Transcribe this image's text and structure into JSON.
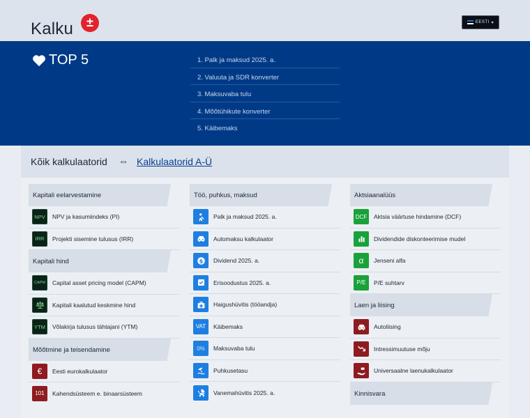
{
  "header": {
    "logo": "Kalku",
    "logo_badge": "±",
    "language": "EESTI"
  },
  "top5": {
    "title": "TOP 5",
    "items": [
      "1. Palk ja maksud 2025. a.",
      "2. Valuuta ja SDR konverter",
      "3. Maksuvaba tulu",
      "4. Mõõtühikute konverter",
      "5. Käibemaks"
    ]
  },
  "panel": {
    "title": "Kõik kalkulaatorid",
    "arrow": "⇔",
    "link": "Kalkulaatorid A-Ü"
  },
  "col1": {
    "s1": {
      "title": "Kapitali eelarvestamine",
      "items": [
        {
          "icon": "NPV",
          "label": "NPV ja kasumiindeks (PI)"
        },
        {
          "icon": "IRR",
          "label": "Projekti sisemine tulusus (IRR)"
        }
      ]
    },
    "s2": {
      "title": "Kapitali hind",
      "items": [
        {
          "icon": "CAPM",
          "label": "Capital asset pricing model (CAPM)"
        },
        {
          "icon": "scales-icon",
          "label": "Kapitali kaalutud keskmine hind"
        },
        {
          "icon": "YTM",
          "label": "Võlakirja tulusus tähtajani (YTM)"
        }
      ]
    },
    "s3": {
      "title": "Mõõtmine ja teisendamine",
      "items": [
        {
          "icon": "€",
          "label": "Eesti eurokalkulaator"
        },
        {
          "icon": "101",
          "label": "Kahendsüsteem e. binaarsüsteem"
        }
      ]
    }
  },
  "col2": {
    "s1": {
      "title": "Töö, puhkus, maksud",
      "items": [
        {
          "icon": "worker-icon",
          "label": "Palk ja maksud 2025. a."
        },
        {
          "icon": "car-icon",
          "label": "Automaksu kalkulaator"
        },
        {
          "icon": "$",
          "label": "Dividend 2025. a."
        },
        {
          "icon": "checkbox-icon",
          "label": "Erisoodustus 2025. a."
        },
        {
          "icon": "medkit-icon",
          "label": "Haigushüvitis (tööandja)"
        },
        {
          "icon": "VAT",
          "label": "Käibemaks"
        },
        {
          "icon": "0%",
          "label": "Maksuvaba tulu"
        },
        {
          "icon": "beach-icon",
          "label": "Puhkusetasu"
        },
        {
          "icon": "stroller-icon",
          "label": "Vanemahüvitis 2025. a."
        }
      ]
    }
  },
  "col3": {
    "s1": {
      "title": "Aktsiaanalüüs",
      "items": [
        {
          "icon": "DCF",
          "label": "Aktsia väärtuse hindamine (DCF)"
        },
        {
          "icon": "bar-chart-icon",
          "label": "Dividendide diskonteerimise mudel"
        },
        {
          "icon": "α",
          "label": "Jenseni alfa"
        },
        {
          "icon": "P/E",
          "label": "P/E suhtarv"
        }
      ]
    },
    "s2": {
      "title": "Laen ja liising",
      "items": [
        {
          "icon": "car-icon",
          "label": "Autoliising"
        },
        {
          "icon": "trend-down-icon",
          "label": "Intressimuutuse mõju"
        },
        {
          "icon": "hand-money-icon",
          "label": "Universaalne laenukalkulaator"
        }
      ]
    },
    "s3": {
      "title": "Kinnisvara"
    }
  },
  "colors": {
    "hero": "#003a87",
    "badge": "#e3232d",
    "icon_blue": "#1f7fe0",
    "icon_green": "#19a23a",
    "icon_red": "#8e1b1f"
  }
}
